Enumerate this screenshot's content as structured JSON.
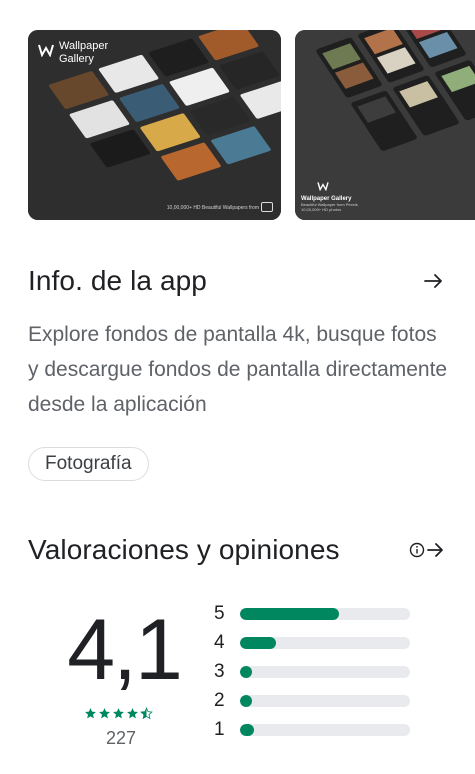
{
  "screenshots": {
    "shot1": {
      "app_name_line1": "Wallpaper",
      "app_name_line2": "Gallery",
      "footer": "10,00,000+ HD Beautiful Wallpapers from"
    },
    "shot2": {
      "app_name": "Wallpaper Gallery",
      "tagline": "Beautiful Wallpaper from Pexels",
      "count": "10,00,000+ HD photos"
    }
  },
  "app_info": {
    "title": "Info. de la app",
    "description": "Explore fondos de pantalla 4k, busque fotos y descargue fondos de pantalla directamente desde la aplicación",
    "category": "Fotografía"
  },
  "ratings": {
    "title": "Valoraciones y opiniones",
    "score": "4,1",
    "stars_value": 4.5,
    "review_count": "227",
    "bars": [
      {
        "label": "5",
        "fraction": 0.58
      },
      {
        "label": "4",
        "fraction": 0.21
      },
      {
        "label": "3",
        "fraction": 0.06
      },
      {
        "label": "2",
        "fraction": 0.07
      },
      {
        "label": "1",
        "fraction": 0.08
      }
    ]
  },
  "colors": {
    "accent_green": "#01875f",
    "bar_track": "#e8eaed",
    "title_text": "#202124",
    "secondary_text": "#5f6368"
  },
  "icons": {
    "info_arrow": "arrow-right-icon",
    "ratings_info": "info-icon",
    "ratings_arrow": "arrow-right-icon"
  }
}
